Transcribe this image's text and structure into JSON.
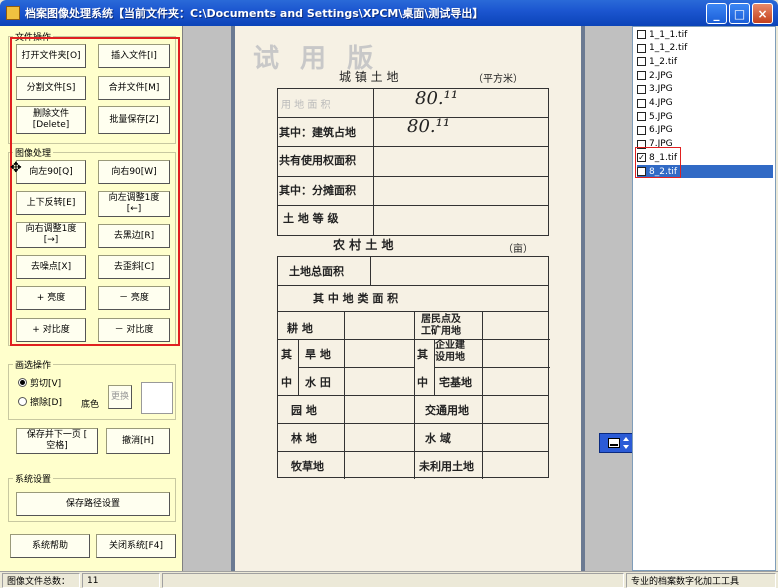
{
  "window": {
    "title": "档案图像处理系统【当前文件夹：C:\\Documents and Settings\\XPCM\\桌面\\测试导出】",
    "minimize": "_",
    "maximize": "□",
    "close": "×"
  },
  "file_ops": {
    "group_title": "文件操作",
    "open_folder": "打开文件夹[O]",
    "insert_file": "插入文件[I]",
    "split_file": "分割文件[S]",
    "merge_file": "合并文件[M]",
    "delete_file": "删除文件\n[Delete]",
    "batch_save": "批量保存[Z]"
  },
  "image_ops": {
    "group_title": "图像处理",
    "rotate_left": "向左90[Q]",
    "rotate_right": "向右90[W]",
    "flip": "上下反转[E]",
    "adjust_left": "向左调整1度\n[←]",
    "adjust_right": "向右调整1度\n[→]",
    "remove_border": "去黑边[R]",
    "denoise": "去噪点[X]",
    "deskew": "去歪斜[C]",
    "brightness_up": "+ 亮度",
    "brightness_down": "－ 亮度",
    "contrast_up": "+ 对比度",
    "contrast_down": "－ 对比度"
  },
  "selection_ops": {
    "group_title": "画选操作",
    "cut_label": "剪切[V]",
    "erase_label": "擦除[D]",
    "bg_color_label": "底色",
    "replace_button": "更换"
  },
  "actions": {
    "save_next": "保存并下一页 [\n空格]",
    "undo": "撤消[H]"
  },
  "settings": {
    "group_title": "系统设置",
    "save_path": "保存路径设置",
    "help": "系统帮助",
    "close_system": "关闭系统[F4]"
  },
  "document": {
    "watermark": "试 用 版",
    "heading_urban": "城   镇   土   地",
    "unit_urban": "（平方米）",
    "row1": "用  地  面  积",
    "row2": "其中：建筑占地",
    "row3": "共有使用权面积",
    "row4": "其中：分摊面积",
    "row5": "土   地   等   级",
    "hand1": "80.¹¹",
    "hand2": "80.¹¹",
    "heading_rural": "农    村    土    地",
    "unit_rural": "（亩）",
    "rural_total": "土地总面积",
    "rural_types": "其    中    地    类    面    积",
    "r_arable": "耕      地",
    "r_qi1": "其",
    "r_zhong1": "中",
    "r_dry": "旱  地",
    "r_paddy": "水  田",
    "r_garden": "园    地",
    "r_forest": "林    地",
    "r_pasture": "牧草地",
    "r_residential": "居民点及\n工矿用地",
    "r_qi2": "其",
    "r_zhong2": "中",
    "r_enterprise": "企业建\n设用地",
    "r_homestead": "宅基地",
    "r_transport": "交通用地",
    "r_water": "水      域",
    "r_unused": "未利用土地"
  },
  "files": [
    {
      "name": "1_1_1.tif",
      "checked": false,
      "selected": false
    },
    {
      "name": "1_1_2.tif",
      "checked": false,
      "selected": false
    },
    {
      "name": "1_2.tif",
      "checked": false,
      "selected": false
    },
    {
      "name": "2.JPG",
      "checked": false,
      "selected": false
    },
    {
      "name": "3.JPG",
      "checked": false,
      "selected": false
    },
    {
      "name": "4.JPG",
      "checked": false,
      "selected": false
    },
    {
      "name": "5.JPG",
      "checked": false,
      "selected": false
    },
    {
      "name": "6.JPG",
      "checked": false,
      "selected": false
    },
    {
      "name": "7.JPG",
      "checked": false,
      "selected": false
    },
    {
      "name": "8_1.tif",
      "checked": true,
      "selected": false
    },
    {
      "name": "8_2.tif",
      "checked": true,
      "selected": true
    }
  ],
  "status": {
    "total_label": "图像文件总数：",
    "total_value": "11",
    "right_text": "专业的档案数字化加工工具"
  },
  "colors": {
    "panel_bg": "#ffffcc",
    "highlight_red": "#e02020",
    "selection_blue": "#316ac5"
  }
}
